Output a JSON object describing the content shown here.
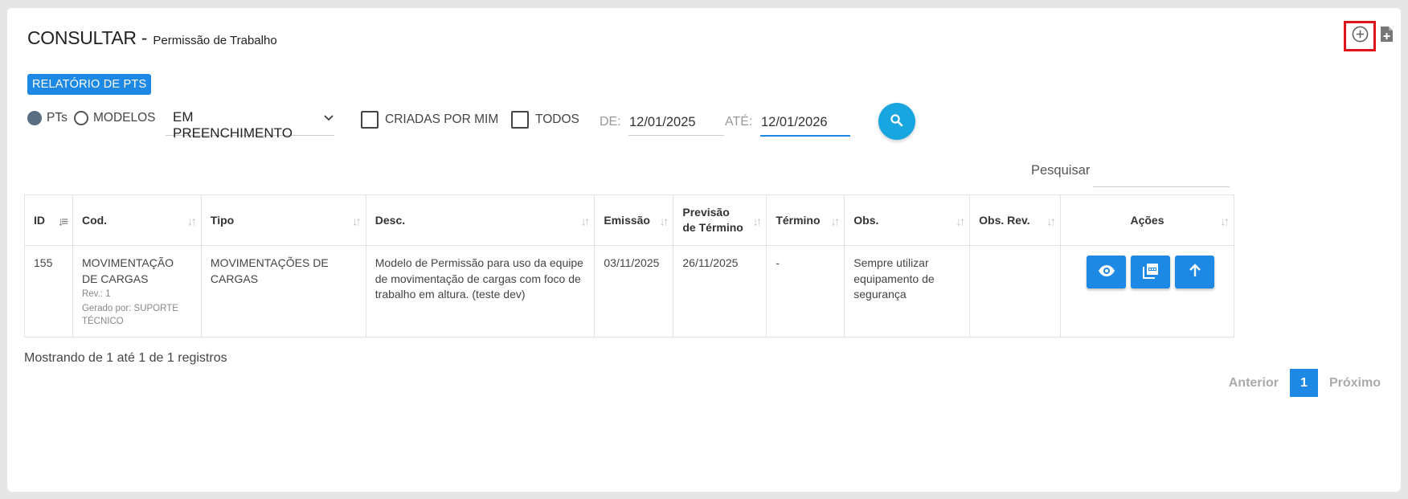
{
  "header": {
    "title": "CONSULTAR",
    "separator": "-",
    "subtitle": "Permissão de Trabalho",
    "add_icon": "plus-circle-icon",
    "doc_icon": "document-add-icon"
  },
  "report_button": "RELATÓRIO DE PTS",
  "filters": {
    "radio_pts": "PTs",
    "radio_modelos": "MODELOS",
    "radio_selected": "PTs",
    "status_select": "EM PREENCHIMENTO",
    "check_criadas": "CRIADAS POR MIM",
    "check_todos": "TODOS",
    "de_label": "DE:",
    "de_value": "12/01/2025",
    "ate_label": "ATÉ:",
    "ate_value": "12/01/2026",
    "search_icon": "search-icon"
  },
  "search": {
    "label": "Pesquisar",
    "value": ""
  },
  "table": {
    "headers": {
      "id": "ID",
      "cod": "Cod.",
      "tipo": "Tipo",
      "desc": "Desc.",
      "emissao": "Emissão",
      "previsao_1": "Previsão",
      "previsao_2": "de Término",
      "termino": "Término",
      "obs": "Obs.",
      "obs_rev": "Obs. Rev.",
      "acoes": "Ações"
    },
    "rows": [
      {
        "id": "155",
        "cod": "MOVIMENTAÇÃO DE CARGAS",
        "rev": "Rev.: 1",
        "gerado": "Gerado por: SUPORTE TÉCNICO",
        "tipo": "MOVIMENTAÇÕES DE CARGAS",
        "desc": "Modelo de Permissão para uso da equipe de movimentação de cargas com foco de trabalho em altura. (teste dev)",
        "emissao": "03/11/2025",
        "previsao": "26/11/2025",
        "termino": "-",
        "obs": "Sempre utilizar equipamento de segurança",
        "obs_rev": ""
      }
    ]
  },
  "info": "Mostrando de 1 até 1 de 1 registros",
  "pagination": {
    "prev": "Anterior",
    "current": "1",
    "next": "Próximo"
  },
  "colors": {
    "primary": "#1e88e5",
    "fab": "#19a6e0",
    "highlight": "#e0121b"
  }
}
